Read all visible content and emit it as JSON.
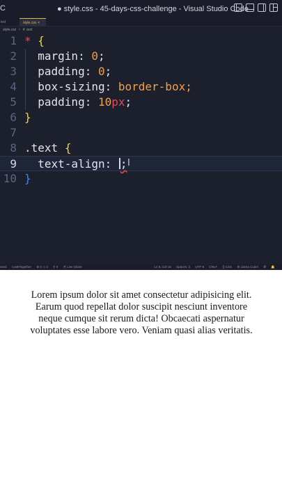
{
  "window": {
    "title": "● style.css - 45-days-css-challenge - Visual Studio Code",
    "left_fragment": "C"
  },
  "tabs": [
    {
      "label": "trol"
    },
    {
      "label": "style.css",
      "close": "×"
    }
  ],
  "breadcrumb": {
    "file": "style.css",
    "separator": ">",
    "symbol_icon": "#",
    "symbol": ".text"
  },
  "editor": {
    "lines": [
      {
        "num": "1"
      },
      {
        "num": "2"
      },
      {
        "num": "3"
      },
      {
        "num": "4"
      },
      {
        "num": "5"
      },
      {
        "num": "6"
      },
      {
        "num": "7"
      },
      {
        "num": "8"
      },
      {
        "num": "9"
      },
      {
        "num": "10"
      }
    ],
    "tokens": {
      "l1_star": "*",
      "l1_brace": "{",
      "l2_prop": "margin:",
      "l2_val": "0",
      "l2_semi": ";",
      "l3_prop": "padding:",
      "l3_val": "0",
      "l3_semi": ";",
      "l4_prop": "box-sizing:",
      "l4_val": "border-box;",
      "l5_prop": "padding:",
      "l5_num": "10",
      "l5_unit": "px",
      "l5_semi": ";",
      "l6_close": "}",
      "l8_sel": ".text",
      "l8_brace": "{",
      "l9_prop": "text-align:",
      "l9_semi": ";",
      "l10_close": "}"
    },
    "mouse_cursor": "I"
  },
  "statusbar": {
    "left": [
      "ssed",
      "CodeTogether",
      "⊗ 0 ⚠ 0",
      "⚲ 0",
      "⦿ Live Share"
    ],
    "right": [
      "Ln 9, Col 15",
      "Spaces: 2",
      "UTF-8",
      "CRLF",
      "{} CSS",
      "⚙ Llama Coder",
      "⦾",
      "🔔"
    ]
  },
  "preview": {
    "text": "Lorem ipsum dolor sit amet consectetur adipisicing elit. Earum quod repellat dolor suscipit nesciunt inventore neque cumque sit rerum dicta! Obcaecati aspernatur voluptates esse labore vero. Veniam quasi alias veritatis."
  },
  "colors": {
    "editor_bg": "#1c1f2c",
    "selector_star": "#e8475a",
    "brace": "#f2d43a",
    "number": "#f2a14a",
    "unit": "#e8475a",
    "closing_brace_active": "#2f8cff",
    "tab_active": "#e6b84c"
  }
}
